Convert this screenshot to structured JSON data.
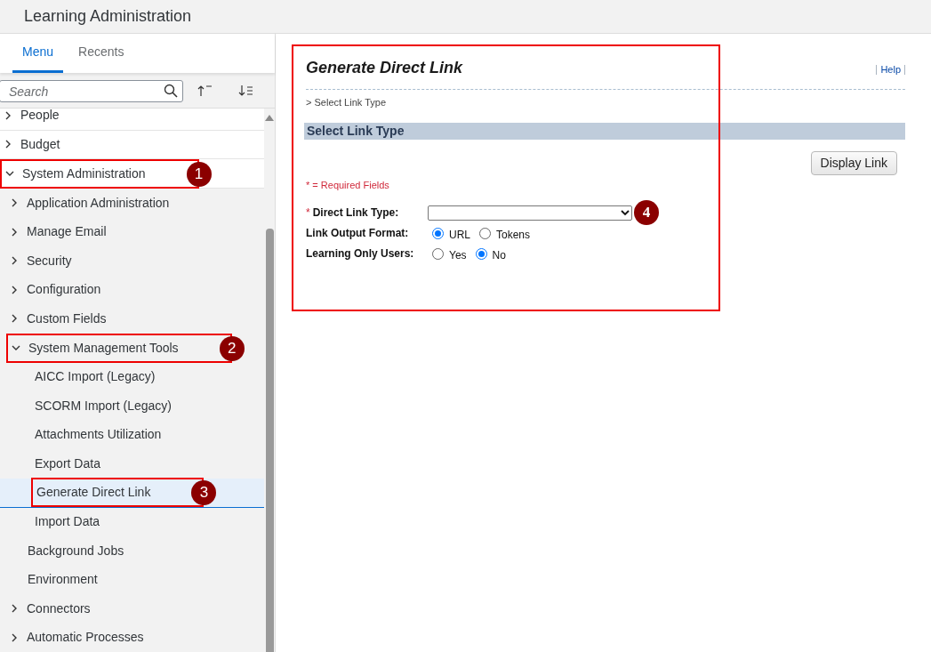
{
  "header": {
    "title": "Learning Administration"
  },
  "sidebar": {
    "tabs": [
      {
        "label": "Menu",
        "selected": true
      },
      {
        "label": "Recents",
        "selected": false
      }
    ],
    "search": {
      "placeholder": "Search"
    },
    "tree": [
      {
        "label": "People",
        "expanded": false,
        "selected": false
      },
      {
        "label": "Budget",
        "expanded": false,
        "selected": false
      },
      {
        "label": "System Administration",
        "expanded": true,
        "selected": false,
        "callout": "1",
        "children": [
          {
            "label": "Application Administration",
            "expanded": false,
            "selected": false
          },
          {
            "label": "Manage Email",
            "expanded": false,
            "selected": false
          },
          {
            "label": "Security",
            "expanded": false,
            "selected": false
          },
          {
            "label": "Configuration",
            "expanded": false,
            "selected": false
          },
          {
            "label": "Custom Fields",
            "expanded": false,
            "selected": false
          },
          {
            "label": "System Management Tools",
            "expanded": true,
            "selected": false,
            "callout": "2",
            "children": [
              {
                "label": "AICC Import (Legacy)",
                "selected": false
              },
              {
                "label": "SCORM Import (Legacy)",
                "selected": false
              },
              {
                "label": "Attachments Utilization",
                "selected": false
              },
              {
                "label": "Export Data",
                "selected": false
              },
              {
                "label": "Generate Direct Link",
                "selected": true,
                "callout": "3"
              },
              {
                "label": "Import Data",
                "selected": false
              }
            ]
          },
          {
            "label": "Background Jobs",
            "selected": false
          },
          {
            "label": "Environment",
            "selected": false
          },
          {
            "label": "Connectors",
            "expanded": false,
            "selected": false
          },
          {
            "label": "Automatic Processes",
            "expanded": false,
            "selected": false
          }
        ]
      }
    ]
  },
  "main": {
    "highlighted": true,
    "title": "Generate Direct Link",
    "help": "Help",
    "breadcrumb": "> Select Link Type",
    "section": "Select Link Type",
    "button": "Display Link",
    "required_note": "* = Required Fields",
    "fields": [
      {
        "kind": "select",
        "marker": "*",
        "label": "Direct Link Type:",
        "callout": "4"
      },
      {
        "kind": "radio",
        "label": "Link Output Format:",
        "options": [
          {
            "label": "URL",
            "selected": true
          },
          {
            "label": "Tokens",
            "selected": false
          }
        ]
      },
      {
        "kind": "radio",
        "label": "Learning Only Users:",
        "options": [
          {
            "label": "Yes",
            "selected": false
          },
          {
            "label": "No",
            "selected": true
          }
        ]
      }
    ]
  }
}
